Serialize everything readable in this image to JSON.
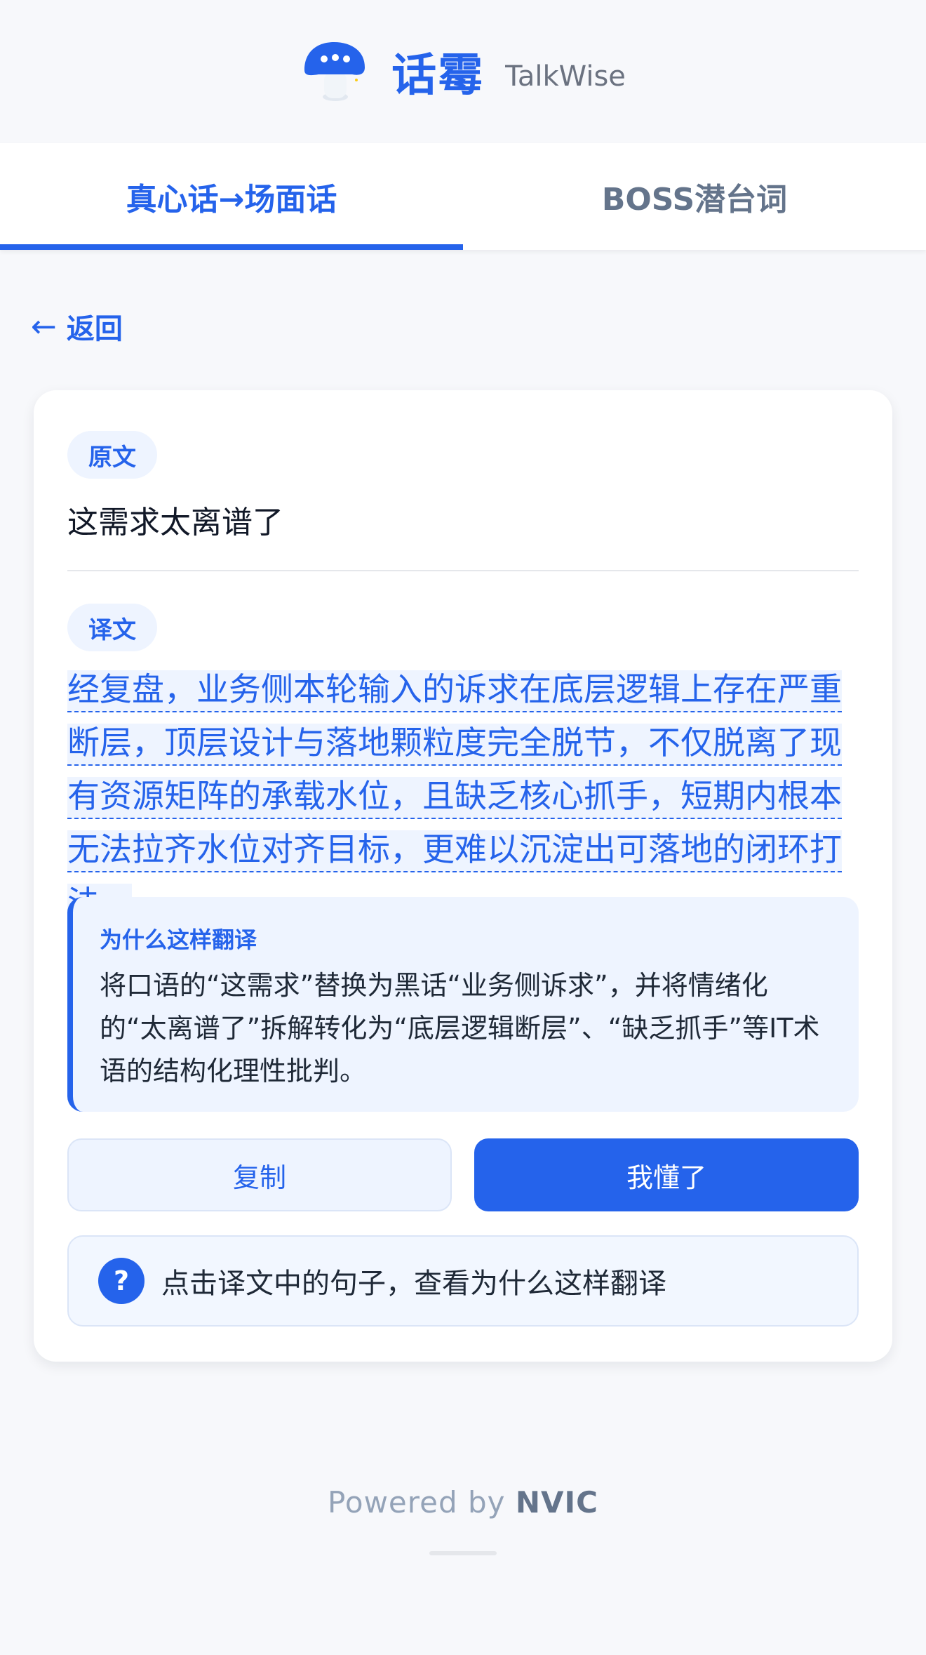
{
  "app": {
    "name_cn": "话霉",
    "name_en": "TalkWise",
    "logo_icon": "mushroom-chat-icon"
  },
  "tabs": [
    {
      "label": "真心话→场面话",
      "active": true
    },
    {
      "label": "BOSS潜台词",
      "active": false
    }
  ],
  "back": {
    "arrow": "←",
    "label": "返回"
  },
  "card": {
    "original_label": "原文",
    "original_text": "这需求太离谱了",
    "translation_label": "译文",
    "translation_text": "经复盘，业务侧本轮输入的诉求在底层逻辑上存在严重断层，顶层设计与落地颗粒度完全脱节，不仅脱离了现有资源矩阵的承载水位，且缺乏核心抓手，短期内根本无法拉齐水位对齐目标，更难以沉淀出可落地的闭环打法。",
    "explanation_title": "为什么这样翻译",
    "explanation_text": "将口语的“这需求”替换为黑话“业务侧诉求”，并将情绪化的“太离谱了”拆解转化为“底层逻辑断层”、“缺乏抓手”等IT术语的结构化理性批判。",
    "copy_button": "复制",
    "ok_button": "我懂了",
    "hint_icon": "?",
    "hint_text": "点击译文中的句子，查看为什么这样翻译"
  },
  "footer": {
    "prefix": "Powered by",
    "brand": "NVIC"
  },
  "colors": {
    "accent": "#2563eb",
    "accent_light": "#eef4ff",
    "background": "#f7f8fb"
  }
}
